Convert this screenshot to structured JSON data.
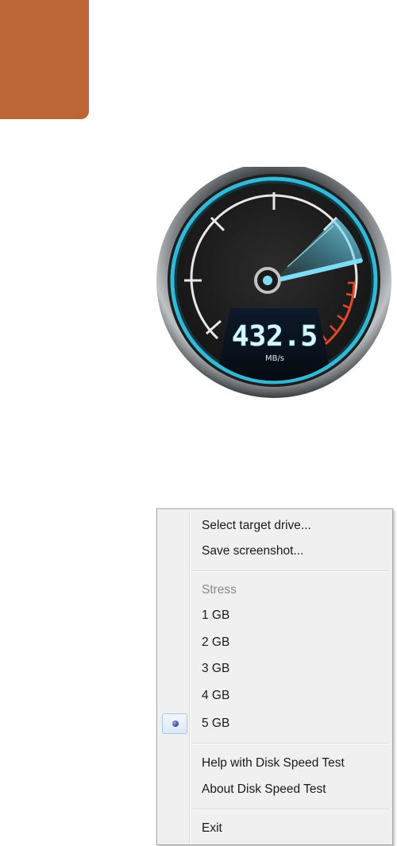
{
  "gauge": {
    "value": "432.5",
    "unit": "MB/s",
    "level": 0.72
  },
  "menu": {
    "items": [
      {
        "label": "Select target drive..."
      },
      {
        "label": "Save screenshot..."
      },
      {
        "label": "Stress",
        "disabled": true
      },
      {
        "label": "1 GB"
      },
      {
        "label": "2 GB"
      },
      {
        "label": "3 GB"
      },
      {
        "label": "4 GB"
      },
      {
        "label": "5 GB",
        "selected": true
      },
      {
        "label": "Help with Disk Speed Test"
      },
      {
        "label": "About Disk Speed Test"
      },
      {
        "label": "Exit"
      }
    ]
  },
  "colors": {
    "accent_tab": "#bc6535",
    "gauge_glow": "#35b8d6",
    "redline": "#e04a2a"
  }
}
